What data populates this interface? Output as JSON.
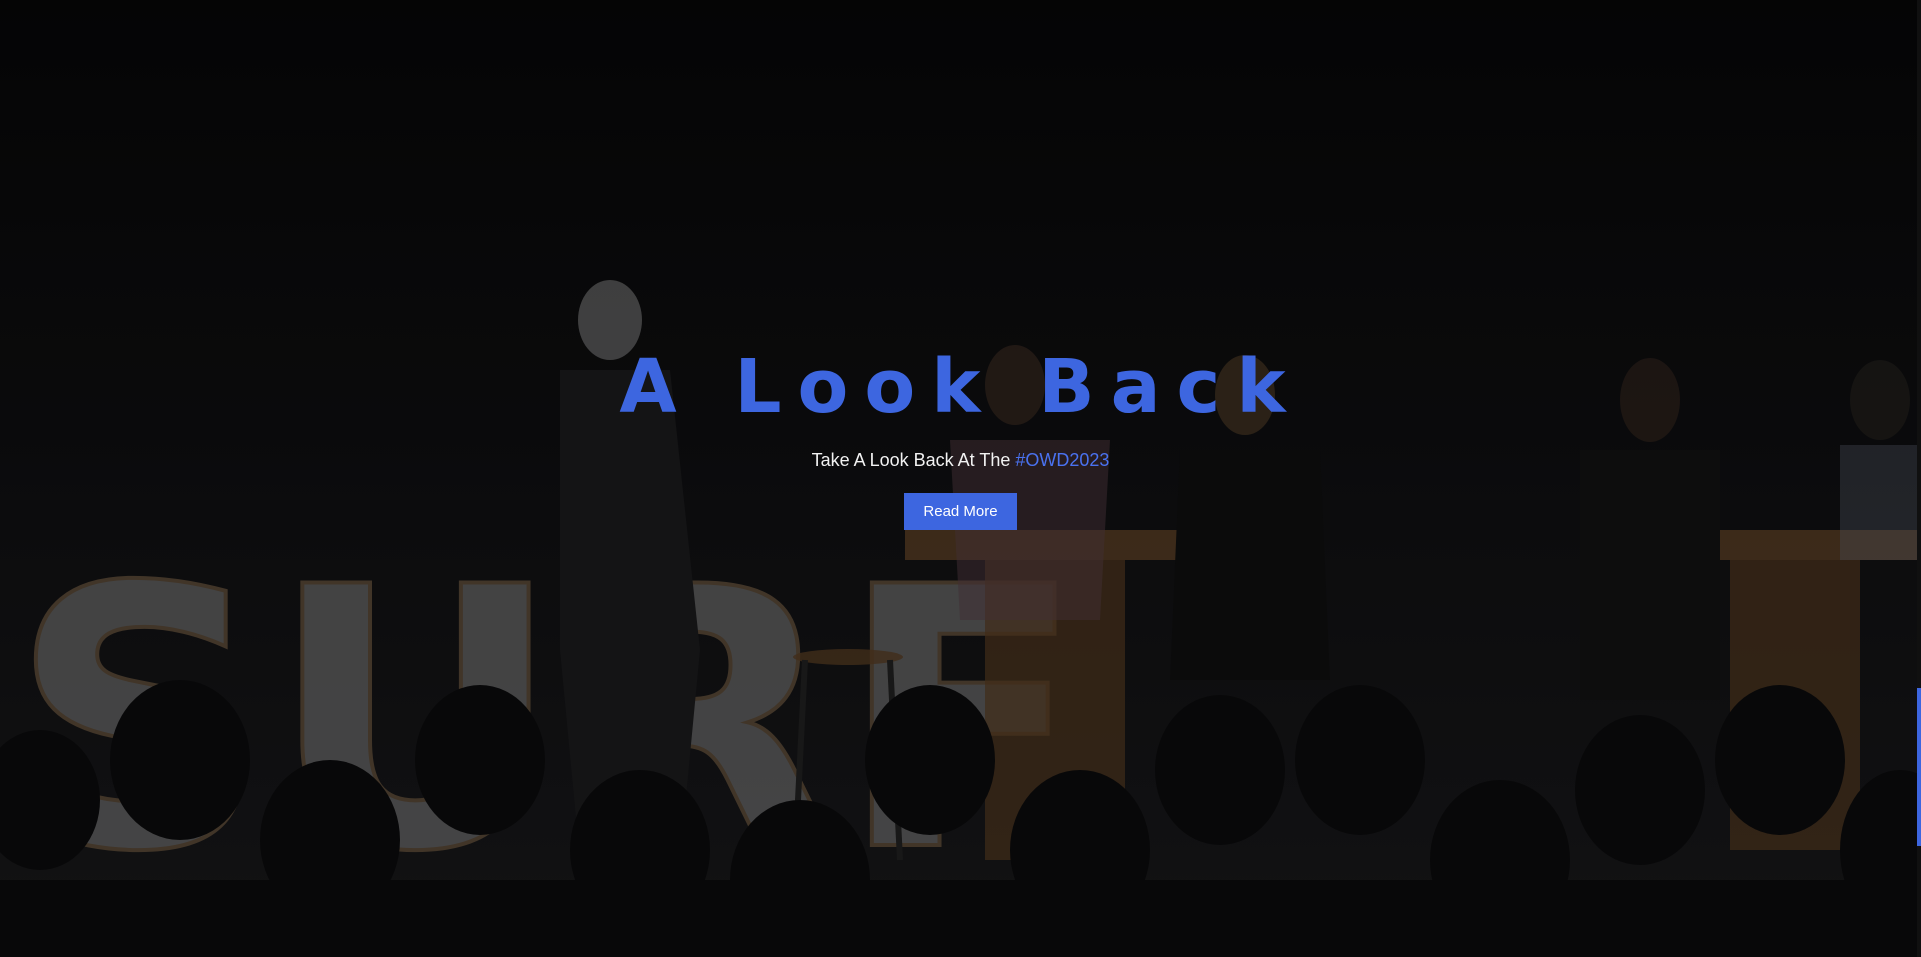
{
  "hero": {
    "title": "A Look Back",
    "subtitle_prefix": "Take A Look Back At The ",
    "subtitle_tag": "#OWD2023",
    "button_label": "Read More"
  },
  "background": {
    "stage_sign_text": "SURF"
  },
  "colors": {
    "accent": "#3d66e0",
    "background": "#0a0a0b",
    "text": "#f2f2f2"
  }
}
